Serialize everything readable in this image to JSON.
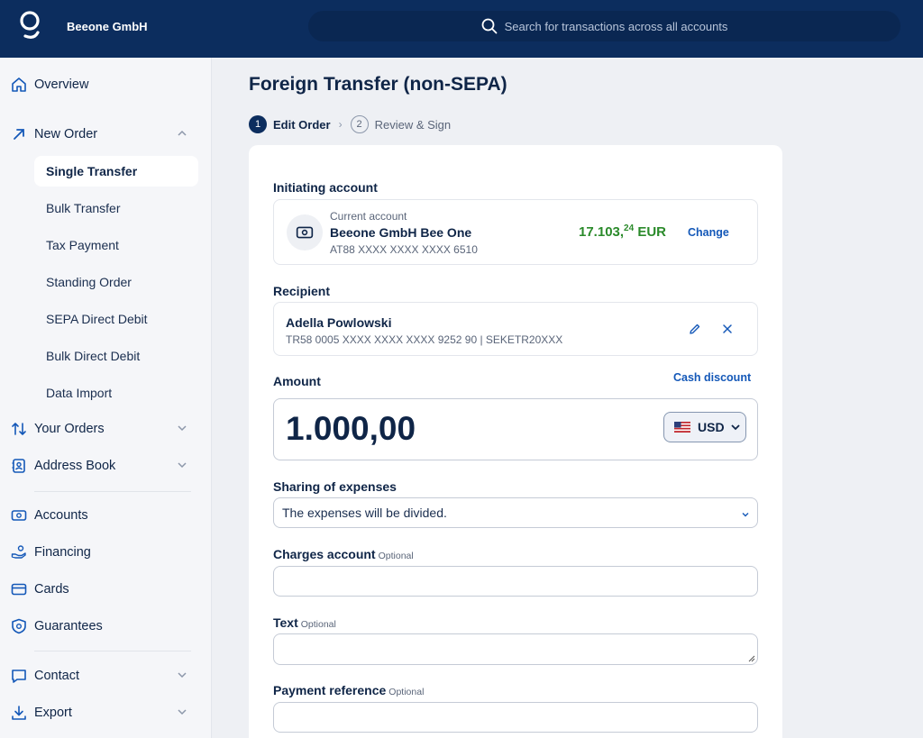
{
  "header": {
    "company": "Beeone GmbH",
    "search_placeholder": "Search for transactions across all accounts"
  },
  "sidebar": {
    "overview": "Overview",
    "new_order": "New Order",
    "sub_items": [
      "Single Transfer",
      "Bulk Transfer",
      "Tax Payment",
      "Standing Order",
      "SEPA Direct Debit",
      "Bulk Direct Debit",
      "Data Import"
    ],
    "your_orders": "Your Orders",
    "address_book": "Address Book",
    "accounts": "Accounts",
    "financing": "Financing",
    "cards": "Cards",
    "guarantees": "Guarantees",
    "contact": "Contact",
    "export": "Export"
  },
  "page": {
    "title": "Foreign Transfer (non-SEPA)",
    "steps": [
      {
        "num": "1",
        "label": "Edit Order"
      },
      {
        "num": "2",
        "label": "Review & Sign"
      }
    ]
  },
  "form": {
    "initiating_label": "Initiating account",
    "account": {
      "type": "Current account",
      "name": "Beeone GmbH Bee One",
      "iban": "AT88 XXXX XXXX XXXX 6510",
      "balance_main": "17.103,",
      "balance_cents": "24",
      "balance_currency": " EUR",
      "change_label": "Change"
    },
    "recipient_label": "Recipient",
    "recipient": {
      "name": "Adella Powlowski",
      "details": "TR58 0005 XXXX XXXX XXXX 9252 90 | SEKETR20XXX"
    },
    "amount_label": "Amount",
    "cash_discount": "Cash discount",
    "amount_value": "1.000,00",
    "currency": "USD",
    "sharing_label": "Sharing of expenses",
    "sharing_value": "The expenses will be divided.",
    "charges_label": "Charges account",
    "text_label": "Text",
    "payment_ref_label": "Payment reference",
    "optional": "Optional"
  },
  "colors": {
    "header_bg": "#0c2d5e",
    "balance_green": "#2a8a2a",
    "link_blue": "#1458b8"
  }
}
